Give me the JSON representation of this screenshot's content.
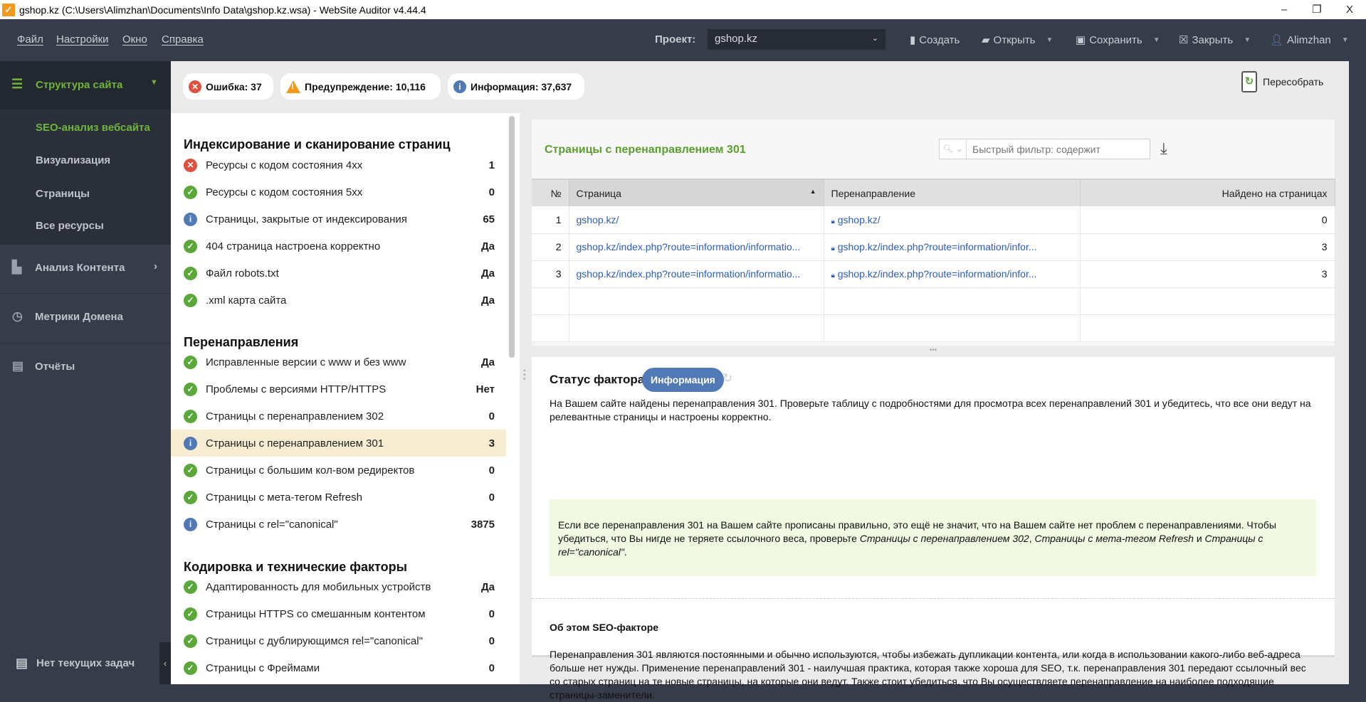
{
  "window": {
    "title": "gshop.kz (C:\\Users\\Alimzhan\\Documents\\Info Data\\gshop.kz.wsa) - WebSite Auditor v4.44.4",
    "minimize": "–",
    "restore": "❐",
    "close": "X"
  },
  "menu": {
    "items": [
      "Файл",
      "Настройки",
      "Окно",
      "Справка"
    ]
  },
  "toolbar": {
    "project_label": "Проект:",
    "project_value": "gshop.kz",
    "create": "Создать",
    "open": "Открыть",
    "save": "Сохранить",
    "close": "Закрыть",
    "user": "Alimzhan"
  },
  "sidebar": {
    "active_section": "Структура сайта",
    "sub_items": [
      "SEO-анализ вебсайта",
      "Визуализация",
      "Страницы",
      "Все ресурсы"
    ],
    "sections": [
      "Анализ Контента",
      "Метрики Домена",
      "Отчёты"
    ],
    "tasks": "Нет текущих задач"
  },
  "summary": {
    "error": "Ошибка: 37",
    "warning": "Предупреждение: 10,116",
    "info": "Информация: 37,637",
    "rebuild": "Пересобрать"
  },
  "factors": [
    {
      "title": "Индексирование и сканирование страниц",
      "rows": [
        {
          "status": "error",
          "name": "Ресурсы с кодом состояния 4xx",
          "value": "1"
        },
        {
          "status": "ok",
          "name": "Ресурсы с кодом состояния 5xx",
          "value": "0"
        },
        {
          "status": "info",
          "name": "Страницы, закрытые от индексирования",
          "value": "65"
        },
        {
          "status": "ok",
          "name": "404 страница настроена корректно",
          "value": "Да"
        },
        {
          "status": "ok",
          "name": "Файл robots.txt",
          "value": "Да"
        },
        {
          "status": "ok",
          "name": ".xml карта сайта",
          "value": "Да"
        }
      ]
    },
    {
      "title": "Перенаправления",
      "rows": [
        {
          "status": "ok",
          "name": "Исправленные версии с www и без www",
          "value": "Да"
        },
        {
          "status": "ok",
          "name": "Проблемы с версиями HTTP/HTTPS",
          "value": "Нет"
        },
        {
          "status": "ok",
          "name": "Страницы с перенаправлением 302",
          "value": "0"
        },
        {
          "status": "info",
          "name": "Страницы с перенаправлением 301",
          "value": "3",
          "selected": true
        },
        {
          "status": "ok",
          "name": "Страницы с большим кол-вом редиректов",
          "value": "0"
        },
        {
          "status": "ok",
          "name": "Страницы с мета-тегом Refresh",
          "value": "0"
        },
        {
          "status": "info",
          "name": "Страницы с rel=\"canonical\"",
          "value": "3875"
        }
      ]
    },
    {
      "title": "Кодировка и технические факторы",
      "rows": [
        {
          "status": "ok",
          "name": "Адаптированность для мобильных устройств",
          "value": "Да"
        },
        {
          "status": "ok",
          "name": "Страницы HTTPS со смешанным контентом",
          "value": "0"
        },
        {
          "status": "ok",
          "name": "Страницы с дублирующимся rel=\"canonical\"",
          "value": "0"
        },
        {
          "status": "ok",
          "name": "Страницы с Фреймами",
          "value": "0"
        }
      ]
    }
  ],
  "detail": {
    "title": "Страницы с перенаправлением 301",
    "filter_placeholder": "Быстрый фильтр: содержит",
    "columns": [
      "№",
      "Страница",
      "Перенаправление",
      "Найдено на страницах"
    ],
    "rows": [
      {
        "n": "1",
        "page": "gshop.kz/",
        "redirect": "gshop.kz/",
        "found": "0"
      },
      {
        "n": "2",
        "page": "gshop.kz/index.php?route=information/informatio...",
        "redirect": "gshop.kz/index.php?route=information/infor...",
        "found": "3"
      },
      {
        "n": "3",
        "page": "gshop.kz/index.php?route=information/informatio...",
        "redirect": "gshop.kz/index.php?route=information/infor...",
        "found": "3"
      }
    ]
  },
  "factor_status": {
    "label": "Статус фактора:",
    "badge": "Информация",
    "description": "На Вашем сайте найдены перенаправления 301. Проверьте таблицу с подробностями для просмотра всех перенаправлений 301 и убедитесь, что все они ведут на релевантные страницы и настроены корректно.",
    "tip_text": "Если все перенаправления 301 на Вашем сайте прописаны правильно, это ещё не значит, что на Вашем сайте нет проблем с перенаправлениями. Чтобы убедиться, что Вы нигде не теряете ссылочного веса, проверьте ",
    "tip_link1": "Страницы с перенаправлением 302",
    "tip_sep1": ", ",
    "tip_link2": "Страницы с мета-тегом Refresh",
    "tip_sep2": " и ",
    "tip_link3": "Страницы с rel=\"canonical\"",
    "tip_end": ".",
    "about_title": "Об этом SEO-факторе",
    "about_text": "Перенаправления 301 являются постоянными и обычно используются, чтобы избежать дупликации контента, или когда в использовании какого-либо веб-адреса больше нет нужды. Применение перенаправлений 301 - наилучшая практика, которая также хороша для SEO, т.к. перенаправления 301 передают ссылочный вес со старых страниц на те новые страницы, на которые они ведут. Также стоит убедиться, что Вы осуществляете перенаправление на наиболее подходящие страницы-заменители."
  },
  "colors": {
    "accent_green": "#5a9e2f",
    "info_blue": "#5179b5",
    "error_red": "#e0513d",
    "warning_orange": "#f39a1c",
    "selected_row": "#f7edd3"
  }
}
